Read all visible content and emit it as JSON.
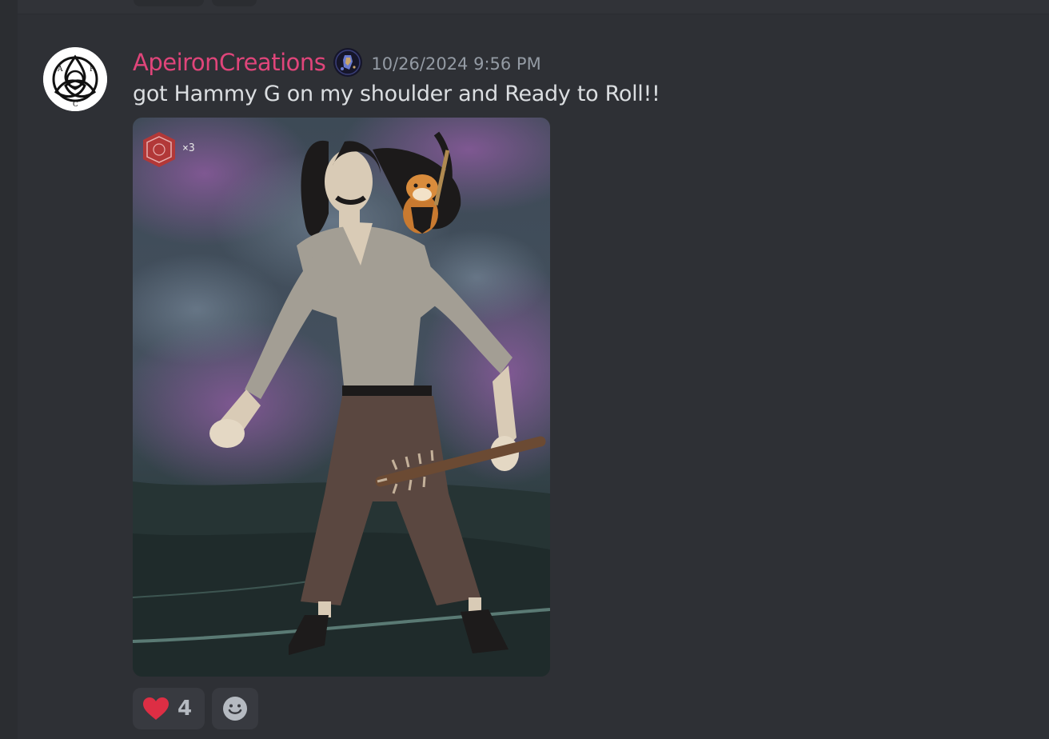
{
  "message": {
    "author": "ApeironCreations",
    "timestamp": "10/26/2024 9:56 PM",
    "content": "got Hammy G on my shoulder and Ready to Roll!!",
    "attachment": {
      "overlay_badge": "×3"
    },
    "avatar_icon": "triquetra-logo",
    "badge_icon": "server-tag-badge"
  },
  "reactions": [
    {
      "emoji": "heart-icon",
      "count": "4"
    },
    {
      "emoji": "add-reaction-icon"
    }
  ],
  "colors": {
    "username": "#e0457a",
    "timestamp": "#949ba4",
    "text": "#dbdee1",
    "background": "#313338"
  }
}
